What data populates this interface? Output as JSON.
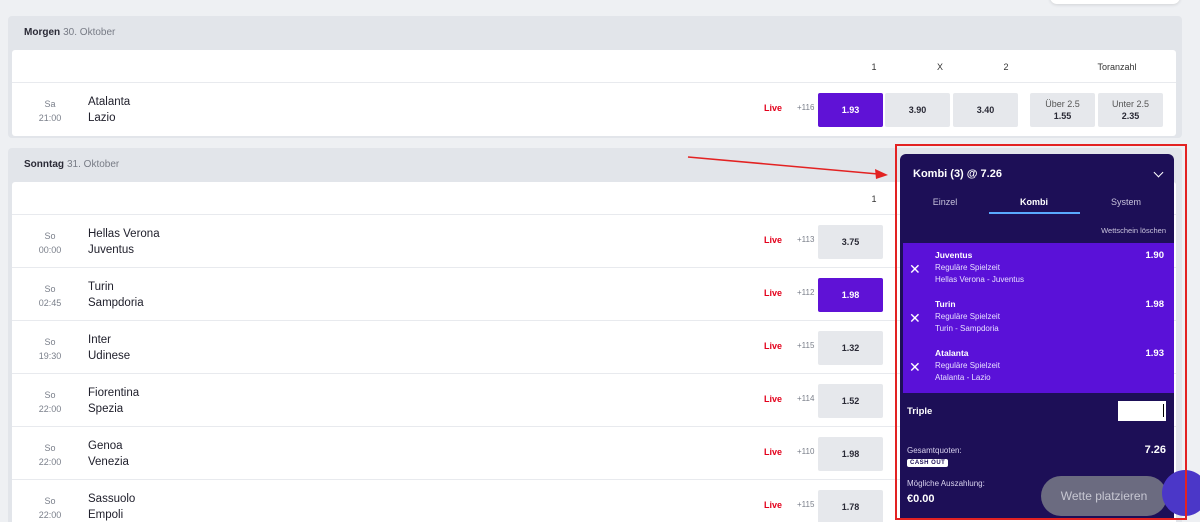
{
  "days": [
    {
      "label": "Morgen",
      "date": "30. Oktober",
      "col_headers": [
        "1",
        "X",
        "2",
        "Toranzahl"
      ],
      "matches": [
        {
          "day": "Sa",
          "time": "21:00",
          "home": "Atalanta",
          "away": "Lazio",
          "live": "Live",
          "more": "+116",
          "odds": [
            "1.93",
            "3.90",
            "3.40"
          ],
          "over_label": "Über 2.5",
          "over_odd": "1.55",
          "under_label": "Unter 2.5",
          "under_odd": "2.35",
          "selected": 0
        }
      ]
    },
    {
      "label": "Sonntag",
      "date": "31. Oktober",
      "col_headers": [
        "1"
      ],
      "matches": [
        {
          "day": "So",
          "time": "00:00",
          "home": "Hellas Verona",
          "away": "Juventus",
          "live": "Live",
          "more": "+113",
          "odd1": "3.75"
        },
        {
          "day": "So",
          "time": "02:45",
          "home": "Turin",
          "away": "Sampdoria",
          "live": "Live",
          "more": "+112",
          "odd1": "1.98",
          "selected": true
        },
        {
          "day": "So",
          "time": "19:30",
          "home": "Inter",
          "away": "Udinese",
          "live": "Live",
          "more": "+115",
          "odd1": "1.32"
        },
        {
          "day": "So",
          "time": "22:00",
          "home": "Fiorentina",
          "away": "Spezia",
          "live": "Live",
          "more": "+114",
          "odd1": "1.52"
        },
        {
          "day": "So",
          "time": "22:00",
          "home": "Genoa",
          "away": "Venezia",
          "live": "Live",
          "more": "+110",
          "odd1": "1.98"
        },
        {
          "day": "So",
          "time": "22:00",
          "home": "Sassuolo",
          "away": "Empoli",
          "live": "Live",
          "more": "+115",
          "odd1": "1.78"
        }
      ]
    }
  ],
  "betslip": {
    "title": "Kombi (3) @ 7.26",
    "tabs": [
      "Einzel",
      "Kombi",
      "System"
    ],
    "active_tab": "Kombi",
    "clear": "Wettschein löschen",
    "picks": [
      {
        "team": "Juventus",
        "market": "Reguläre Spielzeit",
        "match": "Hellas Verona - Juventus",
        "odd": "1.90"
      },
      {
        "team": "Turin",
        "market": "Reguläre Spielzeit",
        "match": "Turin - Sampdoria",
        "odd": "1.98"
      },
      {
        "team": "Atalanta",
        "market": "Reguläre Spielzeit",
        "match": "Atalanta - Lazio",
        "odd": "1.93"
      }
    ],
    "bet_type": "Triple",
    "stake_value": "",
    "total_odds_label": "Gesamtquoten:",
    "total_odds": "7.26",
    "cashout": "CASH OUT",
    "payout_label": "Mögliche Auszahlung:",
    "payout": "€0.00",
    "place_button": "Wette platzieren"
  },
  "colors": {
    "accent": "#5f12d6",
    "slip_bg": "#1d0f57",
    "live": "#e3001b",
    "annotation": "#e32222"
  }
}
